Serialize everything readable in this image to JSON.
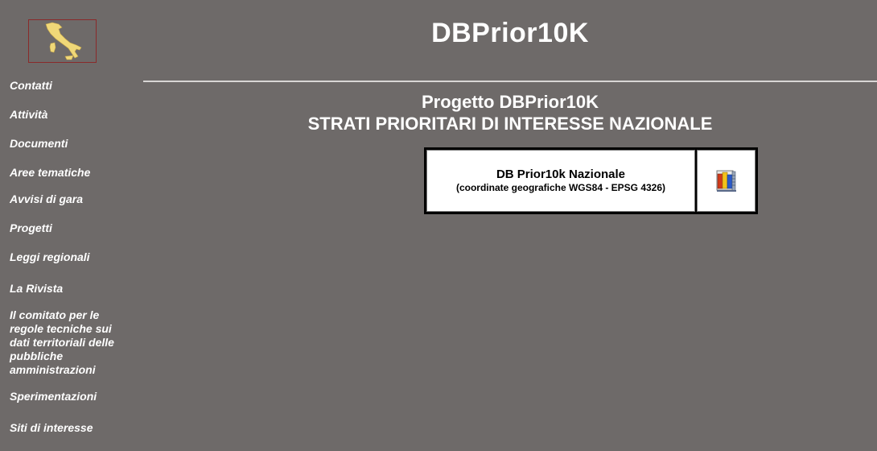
{
  "header": {
    "site_title": "DBPrior10K",
    "project_title_line1": "Progetto DBPrior10K",
    "project_title_line2": "STRATI PRIORITARI DI INTERESSE NAZIONALE"
  },
  "sidebar": {
    "logo_icon": "italy-map-icon",
    "items": [
      {
        "label": "Contatti"
      },
      {
        "label": "Attività"
      },
      {
        "label": "Documenti"
      },
      {
        "label": "Aree tematiche"
      },
      {
        "label": "Avvisi di gara"
      },
      {
        "label": "Progetti"
      },
      {
        "label": "Leggi regionali"
      },
      {
        "label": "La Rivista"
      },
      {
        "label": "Il comitato per le regole tecniche sui dati territoriali delle pubbliche amministrazioni"
      },
      {
        "label": "Sperimentazioni"
      },
      {
        "label": "Siti di interesse"
      }
    ]
  },
  "download": {
    "name": "DB Prior10k Nazionale",
    "subtitle": "(coordinate geografiche WGS84 - EPSG 4326)",
    "icon": "zip-archive-icon"
  },
  "colors": {
    "background": "#6e6a69",
    "text": "#ffffff",
    "map_fill": "#f0d878",
    "logo_border": "#8a2a2a"
  }
}
